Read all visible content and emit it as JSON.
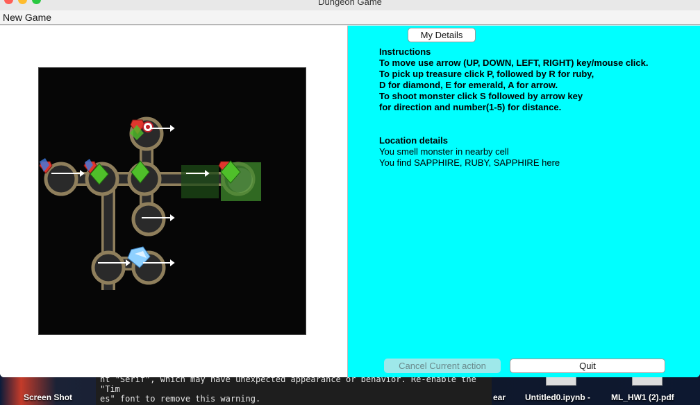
{
  "window": {
    "title": "Dungeon Game"
  },
  "menu": {
    "new_game": "New Game"
  },
  "buttons": {
    "my_details": "My Details",
    "cancel": "Cancel Current action",
    "quit": "Quit"
  },
  "instructions": {
    "heading": "Instructions",
    "lines": [
      "To move use arrow (UP, DOWN, LEFT, RIGHT) key/mouse click.",
      "To pick up treasure click P, followed by R for ruby,",
      "D for diamond, E for emerald, A for arrow.",
      "To shoot monster click S followed by arrow key",
      "for direction and number(1-5) for distance."
    ]
  },
  "location": {
    "heading": "Location details",
    "lines": [
      "You smell monster in nearby cell",
      "You find SAPPHIRE, RUBY, SAPPHIRE here"
    ]
  },
  "terminal": {
    "lines": [
      "nt \"Serif\", which may have unexpected appearance or behavior. Re-enable the \"Tim",
      "es\" font to remove this warning."
    ]
  },
  "desktop": {
    "labels": [
      "Screen Shot",
      "ear",
      "Untitled0.ipynb -",
      "ML_HW1 (2).pdf"
    ]
  },
  "colors": {
    "info_panel": "#00ffff",
    "tunnel_wall": "#9b8a64",
    "tunnel_floor": "#2c2c2c",
    "ruby": "#e0362e",
    "emerald": "#4fbf2a",
    "diamond": "#8fd1ff",
    "sapphire": "#3d7be0",
    "arrow": "#ffffff"
  },
  "icons": {
    "ruby": "ruby-icon",
    "emerald": "emerald-icon",
    "diamond": "diamond-icon",
    "sapphire": "sapphire-icon",
    "arrow": "arrow-icon",
    "player": "player-icon",
    "fog": "monster-smell-icon"
  }
}
